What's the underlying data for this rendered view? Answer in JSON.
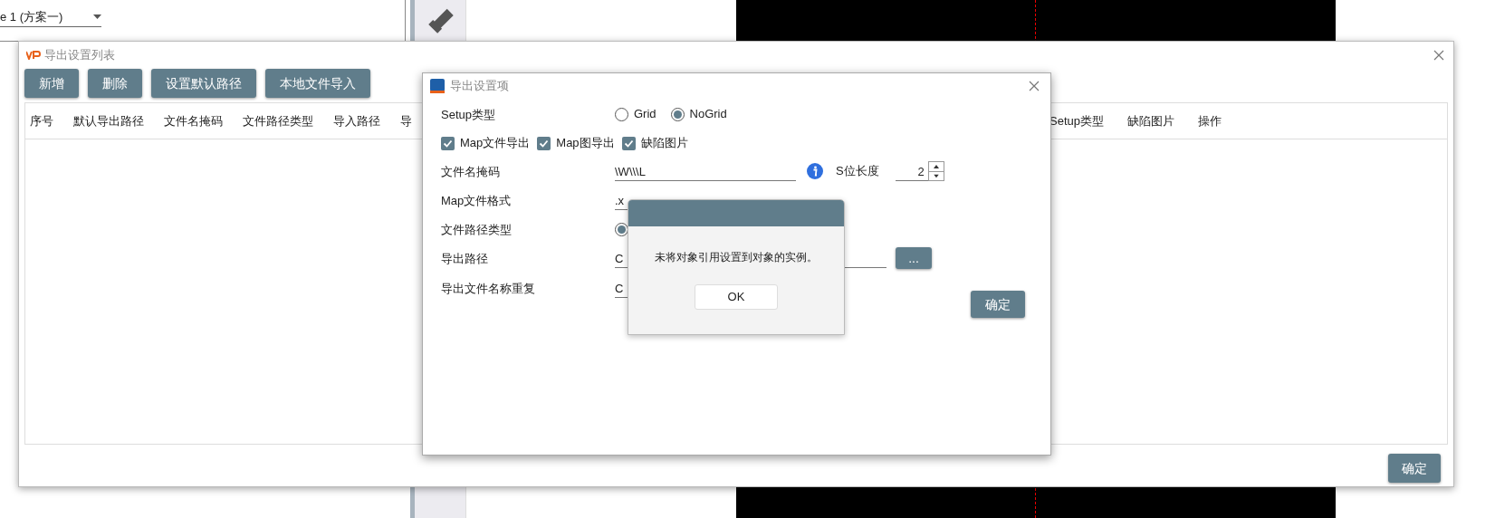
{
  "background": {
    "scheme_select": {
      "value": "e 1 (方案一)"
    }
  },
  "list_window": {
    "title": "导出设置列表",
    "toolbar": [
      "新增",
      "删除",
      "设置默认路径",
      "本地文件导入"
    ],
    "columns_left": [
      "序号",
      "默认导出路径",
      "文件名掩码",
      "文件路径类型",
      "导入路径",
      "导"
    ],
    "columns_right": [
      "Setup类型",
      "缺陷图片",
      "操作"
    ],
    "confirm": "确定"
  },
  "settings_dialog": {
    "title": "导出设置项",
    "setup_type": {
      "label": "Setup类型",
      "options": [
        {
          "label": "Grid",
          "selected": false
        },
        {
          "label": "NoGrid",
          "selected": true
        }
      ]
    },
    "checkboxes": [
      {
        "label": "Map文件导出",
        "checked": true
      },
      {
        "label": "Map图导出",
        "checked": true
      },
      {
        "label": "缺陷图片",
        "checked": true
      }
    ],
    "mask": {
      "label": "文件名掩码",
      "value": "\\W\\\\\\L"
    },
    "s_length": {
      "label": "S位长度",
      "value": "2"
    },
    "map_format": {
      "label": "Map文件格式",
      "value": ".x"
    },
    "path_type": {
      "label": "文件路径类型",
      "selected": true
    },
    "export_path": {
      "label": "导出路径",
      "value": "C",
      "browse": "..."
    },
    "duplicate": {
      "label": "导出文件名称重复",
      "value": "C"
    },
    "confirm": "确定"
  },
  "message_box": {
    "message": "未将对象引用设置到对象的实例。",
    "ok": "OK"
  }
}
